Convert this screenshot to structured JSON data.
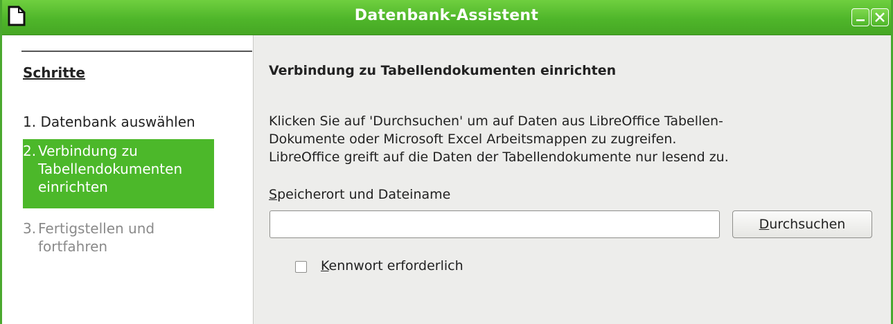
{
  "window": {
    "title": "Datenbank-Assistent",
    "accent_color": "#4cb82a",
    "app_icon": "document-icon",
    "controls": [
      "minimize-icon",
      "close-icon"
    ]
  },
  "sidebar": {
    "heading": "Schritte",
    "steps": [
      {
        "number": "1.",
        "label": "Datenbank auswählen",
        "state": "done"
      },
      {
        "number": "2.",
        "label": "Verbindung zu Tabellendokumenten einrichten",
        "state": "current"
      },
      {
        "number": "3.",
        "label": "Fertigstellen und fortfahren",
        "state": "disabled"
      }
    ]
  },
  "main": {
    "heading": "Verbindung zu Tabellendokumenten einrichten",
    "description": "Klicken Sie auf 'Durchsuchen' um auf Daten aus LibreOffice Tabellen-\nDokumente oder Microsoft Excel Arbeitsmappen zu zugreifen.\nLibreOffice greift auf die Daten der Tabellendokumente nur lesend zu.",
    "path_label_mnemonic": "S",
    "path_label_rest": "peicherort und Dateiname",
    "path_value": "",
    "browse_mnemonic": "D",
    "browse_rest": "urchsuchen",
    "password_mnemonic": "K",
    "password_rest": "ennwort erforderlich",
    "password_checked": false
  }
}
